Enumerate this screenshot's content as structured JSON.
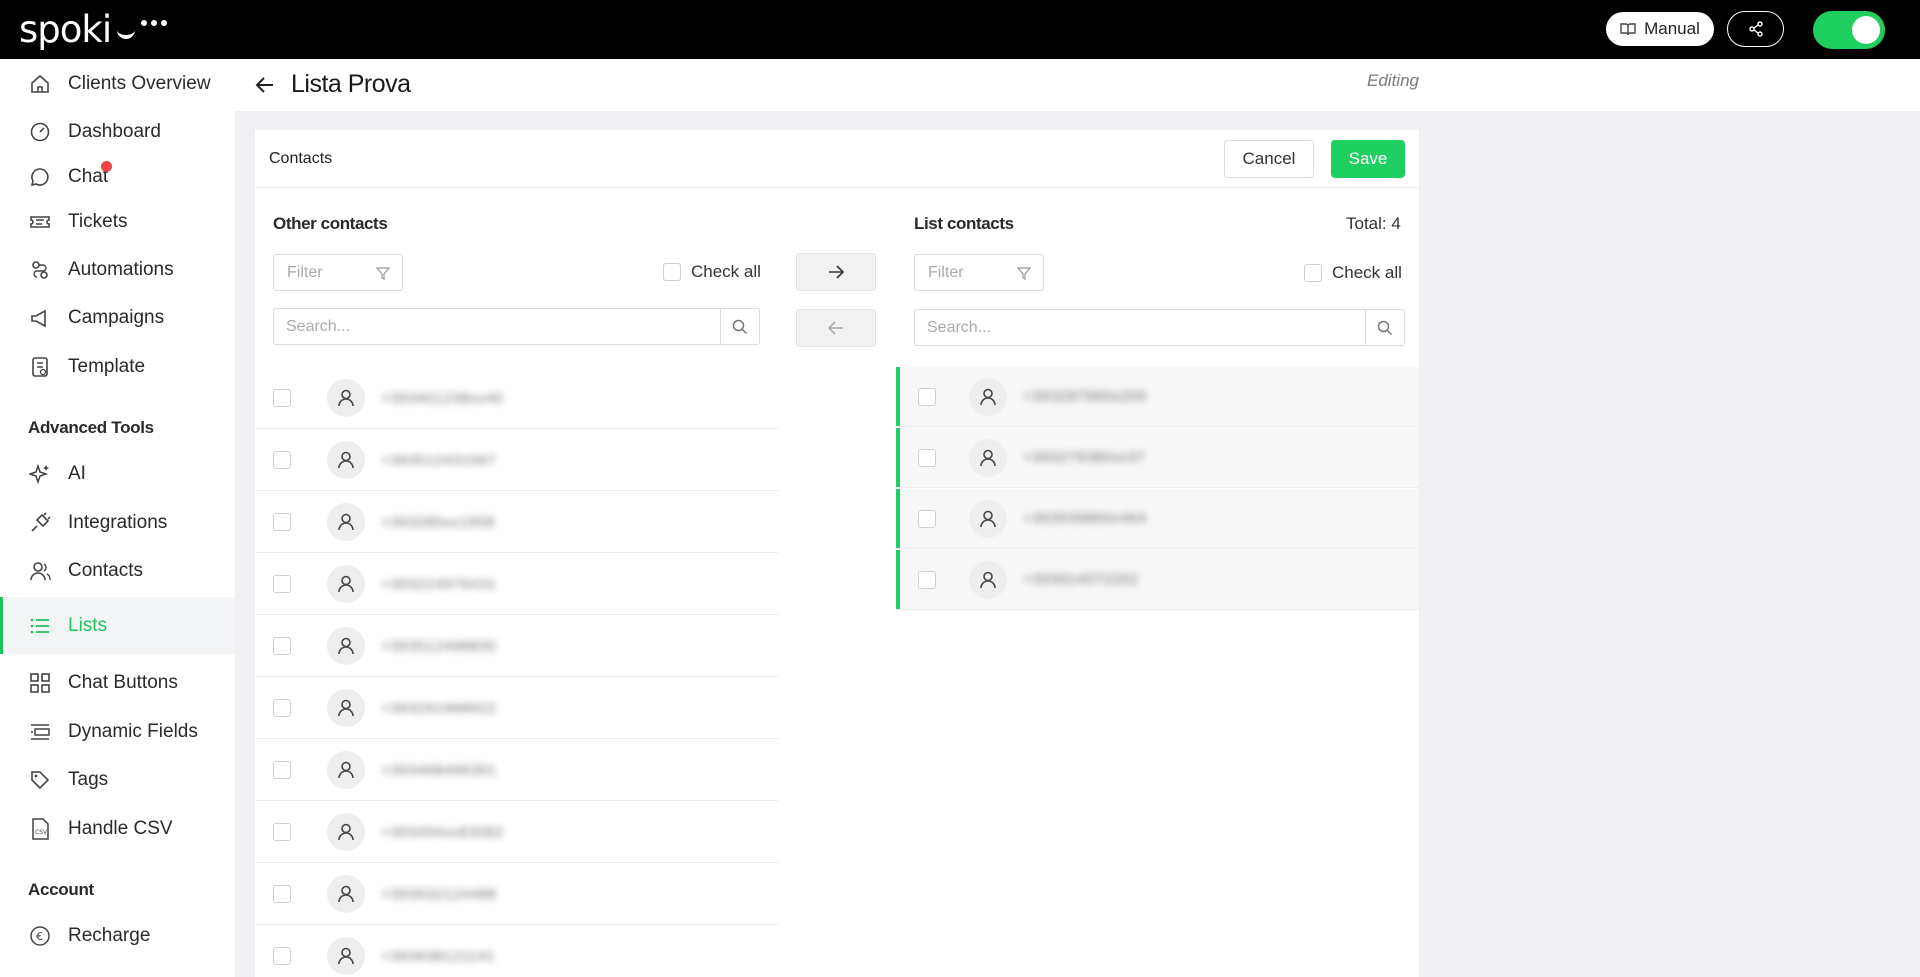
{
  "brand": {
    "logo_text": "spoki"
  },
  "topbar": {
    "manual_label": "Manual",
    "toggle_on": true,
    "accent": "#1fcf5f"
  },
  "sidebar": {
    "items": [
      {
        "label": "Clients Overview",
        "icon": "home-icon"
      },
      {
        "label": "Dashboard",
        "icon": "gauge-icon"
      },
      {
        "label": "Chat",
        "icon": "chat-icon",
        "has_notification": true
      },
      {
        "label": "Tickets",
        "icon": "ticket-icon"
      },
      {
        "label": "Automations",
        "icon": "automation-icon"
      },
      {
        "label": "Campaigns",
        "icon": "megaphone-icon"
      },
      {
        "label": "Template",
        "icon": "template-icon"
      }
    ],
    "section_tools": "Advanced Tools",
    "tools": [
      {
        "label": "AI",
        "icon": "sparkle-icon"
      },
      {
        "label": "Integrations",
        "icon": "plug-icon"
      },
      {
        "label": "Contacts",
        "icon": "contacts-icon"
      },
      {
        "label": "Lists",
        "icon": "list-icon",
        "active": true
      },
      {
        "label": "Chat Buttons",
        "icon": "widgets-icon"
      },
      {
        "label": "Dynamic Fields",
        "icon": "fields-icon"
      },
      {
        "label": "Tags",
        "icon": "tag-icon"
      },
      {
        "label": "Handle CSV",
        "icon": "csv-file-icon"
      }
    ],
    "section_account": "Account",
    "account": [
      {
        "label": "Recharge",
        "icon": "euro-icon"
      }
    ]
  },
  "header": {
    "title": "Lista Prova",
    "status": "Editing"
  },
  "card": {
    "title": "Contacts",
    "cancel_label": "Cancel",
    "save_label": "Save",
    "left": {
      "title": "Other contacts",
      "filter_placeholder": "Filter",
      "check_all_label": "Check all",
      "search_placeholder": "Search...",
      "contacts": [
        "+393401238xx40",
        "+393512431567",
        "+393285xx1958",
        "+393224979431",
        "+393512498830",
        "+393291968922",
        "+393468496391",
        "+393494xx83082",
        "+393932124488",
        "+393938121141"
      ]
    },
    "right": {
      "title": "List contacts",
      "total": "Total: 4",
      "filter_placeholder": "Filter",
      "check_all_label": "Check all",
      "search_placeholder": "Search...",
      "contacts": [
        "+393287966x209",
        "+393279380xx37",
        "+393939860x464",
        "+393914072202"
      ]
    }
  }
}
